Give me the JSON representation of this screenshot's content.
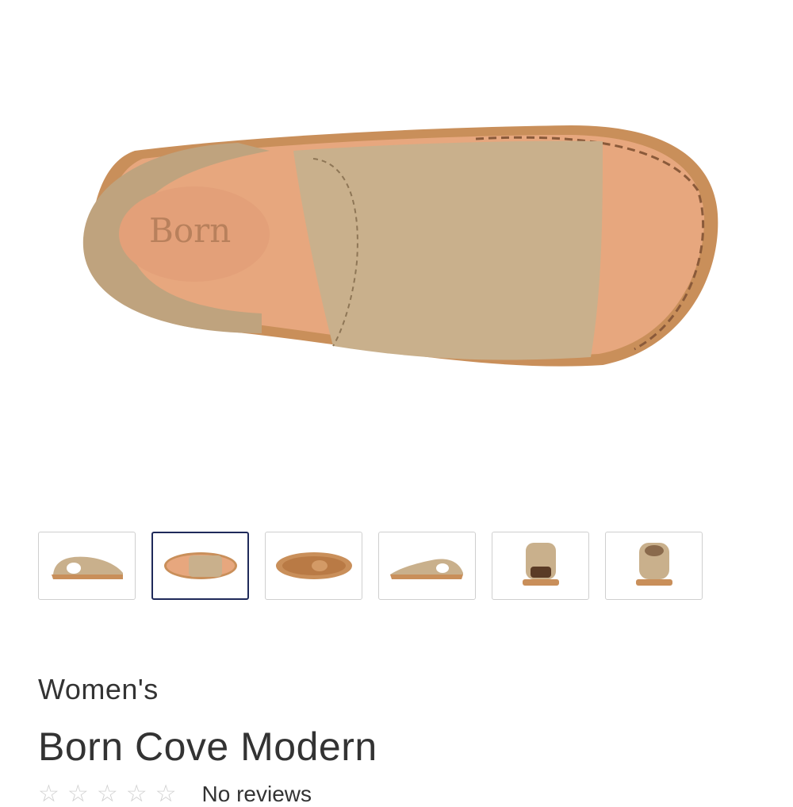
{
  "product": {
    "category": "Women's",
    "name": "Born Cove Modern",
    "image_brand_mark": "Born",
    "rating": {
      "stars_filled": 0,
      "stars_total": 5,
      "text": "No reviews"
    }
  },
  "gallery": {
    "selected_index": 1,
    "thumbnails": [
      {
        "view": "side-inner"
      },
      {
        "view": "top"
      },
      {
        "view": "sole"
      },
      {
        "view": "side-outer"
      },
      {
        "view": "front"
      },
      {
        "view": "back"
      }
    ]
  },
  "colors": {
    "suede": "#c9b08c",
    "footbed": "#e7a77e",
    "sole": "#c98f5a",
    "selected_border": "#1f2a5a",
    "thumb_border": "#cfcfcf"
  }
}
